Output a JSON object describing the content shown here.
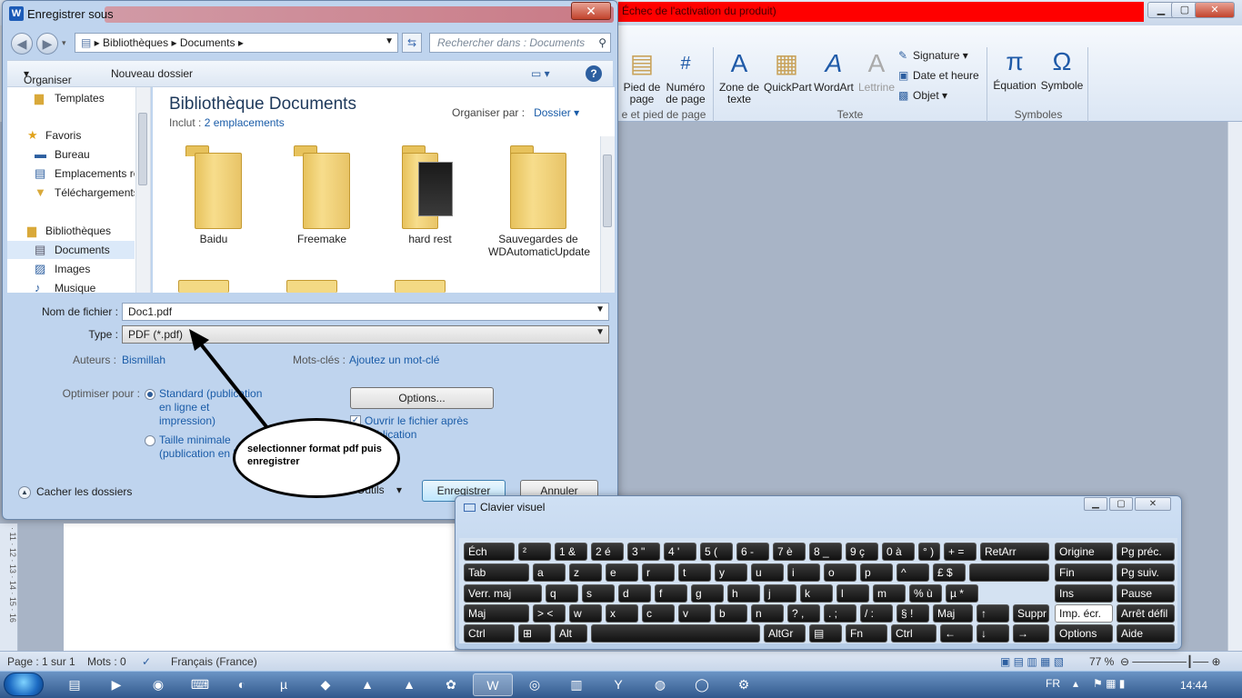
{
  "word": {
    "activation_text": "Échec de l'activation du produit)",
    "ribbon": {
      "pied_de_page": "Pied de\npage",
      "numero_de_page": "Numéro\nde page",
      "header_group_label": "e et pied de page",
      "zone_de_texte": "Zone de\ntexte",
      "quickpart": "QuickPart",
      "wordart": "WordArt",
      "lettrine": "Lettrine",
      "signature": "Signature",
      "date_et_heure": "Date et heure",
      "objet": "Objet",
      "texte_group": "Texte",
      "equation": "Équation",
      "symbole": "Symbole",
      "symboles_group": "Symboles"
    },
    "status": {
      "page": "Page : 1 sur 1",
      "words": "Mots : 0",
      "language": "Français (France)",
      "zoom": "77 %"
    }
  },
  "dialog": {
    "title": "Enregistrer sous",
    "word_icon": "W",
    "breadcrumb": [
      "Bibliothèques",
      "Documents"
    ],
    "search_placeholder": "Rechercher dans : Documents",
    "toolbar": {
      "organize": "Organiser",
      "new_folder": "Nouveau dossier"
    },
    "nav_items": [
      {
        "label": "Templates",
        "icon": "folder-icon"
      },
      {
        "label": "Favoris",
        "icon": "star-icon"
      },
      {
        "label": "Bureau",
        "icon": "desktop-icon"
      },
      {
        "label": "Emplacements ré",
        "icon": "recent-places-icon"
      },
      {
        "label": "Téléchargements",
        "icon": "downloads-icon"
      },
      {
        "label": "Bibliothèques",
        "icon": "libraries-icon"
      },
      {
        "label": "Documents",
        "icon": "documents-icon"
      },
      {
        "label": "Images",
        "icon": "images-icon"
      },
      {
        "label": "Musique",
        "icon": "music-icon"
      }
    ],
    "library_title": "Bibliothèque Documents",
    "include_label": "Inclut :",
    "include_link": "2 emplacements",
    "arrange_label": "Organiser par :",
    "arrange_value": "Dossier",
    "folders": [
      "Baidu",
      "Freemake",
      "hard rest",
      "Sauvegardes de WDAutomaticUpdate"
    ],
    "filename_label": "Nom de fichier :",
    "filename_value": "Doc1.pdf",
    "type_label": "Type :",
    "type_value": "PDF (*.pdf)",
    "authors_label": "Auteurs :",
    "authors_value": "Bismillah",
    "keywords_label": "Mots-clés :",
    "keywords_value": "Ajoutez un mot-clé",
    "optimize_label": "Optimiser pour :",
    "opt_standard": "Standard (publication en ligne et impression)",
    "opt_minimal": "Taille minimale (publication en ligne)",
    "options_button": "Options...",
    "open_after": "Ouvrir le fichier après publication",
    "hide_folders": "Cacher les dossiers",
    "tools": "Outils",
    "save": "Enregistrer",
    "cancel": "Annuler"
  },
  "annotation": {
    "text": "selectionner format pdf puis enregistrer"
  },
  "keyboard": {
    "title": "Clavier visuel",
    "rows": [
      [
        [
          "Éch",
          510,
          56
        ],
        [
          "²",
          570,
          36
        ],
        [
          "1 &",
          610,
          36
        ],
        [
          "2 é",
          650,
          36
        ],
        [
          "3 \"",
          690,
          36
        ],
        [
          "4 '",
          730,
          36
        ],
        [
          "5 (",
          770,
          36
        ],
        [
          "6 -",
          810,
          36
        ],
        [
          "7 è",
          850,
          36
        ],
        [
          "8 _",
          890,
          36
        ],
        [
          "9 ç",
          930,
          36
        ],
        [
          "0 à",
          970,
          36
        ],
        [
          "° )",
          1010,
          24
        ],
        [
          "+ =",
          1038,
          36
        ],
        [
          "RetArr",
          1078,
          76
        ],
        [
          "Origine",
          1160,
          64
        ],
        [
          "Pg préc.",
          1228,
          64
        ]
      ],
      [
        [
          "Tab",
          510,
          72
        ],
        [
          "a",
          586,
          36
        ],
        [
          "z",
          626,
          36
        ],
        [
          "e",
          666,
          36
        ],
        [
          "r",
          706,
          36
        ],
        [
          "t",
          746,
          36
        ],
        [
          "y",
          786,
          36
        ],
        [
          "u",
          826,
          36
        ],
        [
          "i",
          866,
          36
        ],
        [
          "o",
          906,
          36
        ],
        [
          "p",
          946,
          36
        ],
        [
          "^",
          986,
          36
        ],
        [
          "£ $",
          1026,
          36
        ],
        [
          "",
          1066,
          88
        ],
        [
          "Fin",
          1160,
          64
        ],
        [
          "Pg suiv.",
          1228,
          64
        ]
      ],
      [
        [
          "Verr. maj",
          510,
          86
        ],
        [
          "q",
          600,
          36
        ],
        [
          "s",
          640,
          36
        ],
        [
          "d",
          680,
          36
        ],
        [
          "f",
          720,
          36
        ],
        [
          "g",
          760,
          36
        ],
        [
          "h",
          800,
          36
        ],
        [
          "j",
          840,
          36
        ],
        [
          "k",
          880,
          36
        ],
        [
          "l",
          920,
          36
        ],
        [
          "m",
          960,
          36
        ],
        [
          "% ù",
          1000,
          36
        ],
        [
          "µ *",
          1040,
          36
        ],
        [
          "Ins",
          1160,
          64
        ],
        [
          "Pause",
          1228,
          64
        ]
      ],
      [
        [
          "Maj",
          510,
          72
        ],
        [
          "> <",
          586,
          36
        ],
        [
          "w",
          626,
          36
        ],
        [
          "x",
          666,
          36
        ],
        [
          "c",
          706,
          36
        ],
        [
          "v",
          746,
          36
        ],
        [
          "b",
          786,
          36
        ],
        [
          "n",
          826,
          36
        ],
        [
          "? ,",
          866,
          36
        ],
        [
          ". ;",
          906,
          36
        ],
        [
          "/ :",
          946,
          36
        ],
        [
          "§ !",
          986,
          36
        ],
        [
          "Maj",
          1026,
          44
        ],
        [
          "↑",
          1074,
          36
        ],
        [
          "Suppr",
          1114,
          40
        ],
        [
          "Imp. écr.",
          1160,
          64
        ],
        [
          "Arrêt défil",
          1228,
          64
        ]
      ],
      [
        [
          "Ctrl",
          510,
          56
        ],
        [
          "⊞",
          570,
          36
        ],
        [
          "Alt",
          610,
          36
        ],
        [
          "",
          650,
          186
        ],
        [
          "AltGr",
          840,
          46
        ],
        [
          "▤",
          890,
          36
        ],
        [
          "Fn",
          930,
          46
        ],
        [
          "Ctrl",
          980,
          50
        ],
        [
          "←",
          1034,
          36
        ],
        [
          "↓",
          1074,
          36
        ],
        [
          "→",
          1114,
          40
        ],
        [
          "Options",
          1160,
          64
        ],
        [
          "Aide",
          1228,
          64
        ]
      ]
    ]
  },
  "taskbar": {
    "lang": "FR",
    "time": "14:44"
  }
}
